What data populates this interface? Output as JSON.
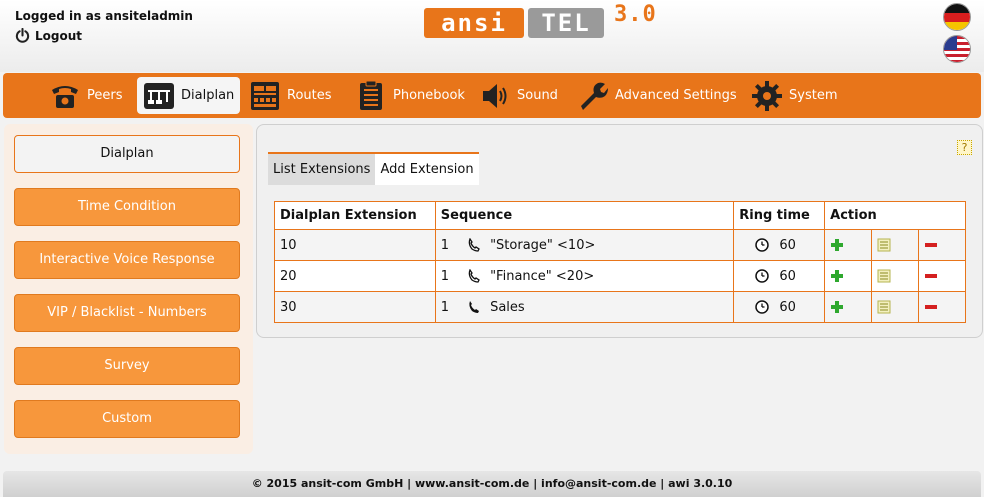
{
  "header": {
    "login_text": "Logged in as ansiteladmin",
    "logout_label": "Logout",
    "logo": {
      "part1": "ansi",
      "part2": "TEL",
      "version": "3.0"
    },
    "flags": [
      "germany-flag",
      "us-flag"
    ]
  },
  "nav": {
    "items": [
      {
        "label": "Peers",
        "icon": "telephone-icon"
      },
      {
        "label": "Dialplan",
        "icon": "dialplan-icon"
      },
      {
        "label": "Routes",
        "icon": "routes-icon"
      },
      {
        "label": "Phonebook",
        "icon": "phonebook-icon"
      },
      {
        "label": "Sound",
        "icon": "speaker-icon"
      },
      {
        "label": "Advanced Settings",
        "icon": "wrench-icon"
      },
      {
        "label": "System",
        "icon": "gear-icon"
      }
    ],
    "active": "Dialplan"
  },
  "sidebar": {
    "items": [
      {
        "label": "Dialplan"
      },
      {
        "label": "Time Condition"
      },
      {
        "label": "Interactive Voice Response"
      },
      {
        "label": "VIP / Blacklist - Numbers"
      },
      {
        "label": "Survey"
      },
      {
        "label": "Custom"
      }
    ],
    "active": "Dialplan"
  },
  "main": {
    "help_label": "?",
    "tabs": [
      {
        "label": "List Extensions"
      },
      {
        "label": "Add Extension"
      }
    ],
    "active_tab": "List Extensions",
    "table": {
      "headers": [
        "Dialplan Extension",
        "Sequence",
        "Ring time",
        "Action"
      ],
      "rows": [
        {
          "extension": "10",
          "seq_num": "1",
          "seq_target": "\"Storage\" <10>",
          "ring_time": "60"
        },
        {
          "extension": "20",
          "seq_num": "1",
          "seq_target": "\"Finance\" <20>",
          "ring_time": "60"
        },
        {
          "extension": "30",
          "seq_num": "1",
          "seq_target": "Sales",
          "ring_time": "60"
        }
      ]
    }
  },
  "footer": {
    "text": "© 2015 ansit-com GmbH | www.ansit-com.de | info@ansit-com.de | awi 3.0.10"
  },
  "colors": {
    "accent": "#e8751a",
    "sidebar_button": "#f7973c",
    "add_icon": "#2ea82e",
    "delete_icon": "#d42020",
    "edit_icon": "#c8c84a"
  }
}
